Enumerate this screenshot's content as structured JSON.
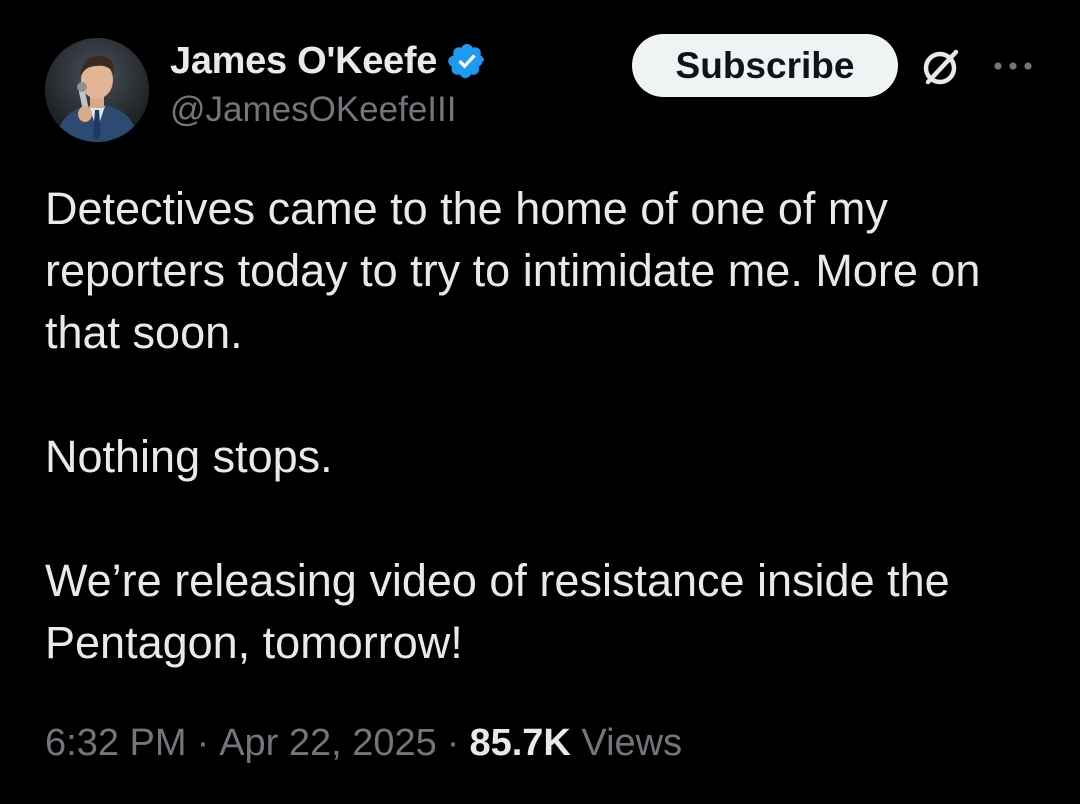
{
  "author": {
    "display_name": "James O'Keefe",
    "handle": "@JamesOKeefeIII",
    "verified": true,
    "avatar": "profile-photo"
  },
  "actions": {
    "subscribe_label": "Subscribe",
    "grok_icon": "grok-icon",
    "more_icon": "more-options-icon"
  },
  "tweet": {
    "paragraphs": [
      "Detectives came to the home of one of my reporters today to try to intimidate me. More on that soon.",
      "Nothing stops.",
      "We’re releasing video of resistance inside the Pentagon, tomorrow!"
    ]
  },
  "meta": {
    "time": "6:32 PM",
    "separator": "·",
    "date": "Apr 22, 2025",
    "views_count": "85.7K",
    "views_label": "Views"
  },
  "colors": {
    "background": "#000000",
    "text_primary": "#e7e9ea",
    "text_secondary": "#71767b",
    "verified_badge": "#1d9bf0",
    "button_bg": "#eff3f4",
    "button_text": "#0f1419"
  }
}
